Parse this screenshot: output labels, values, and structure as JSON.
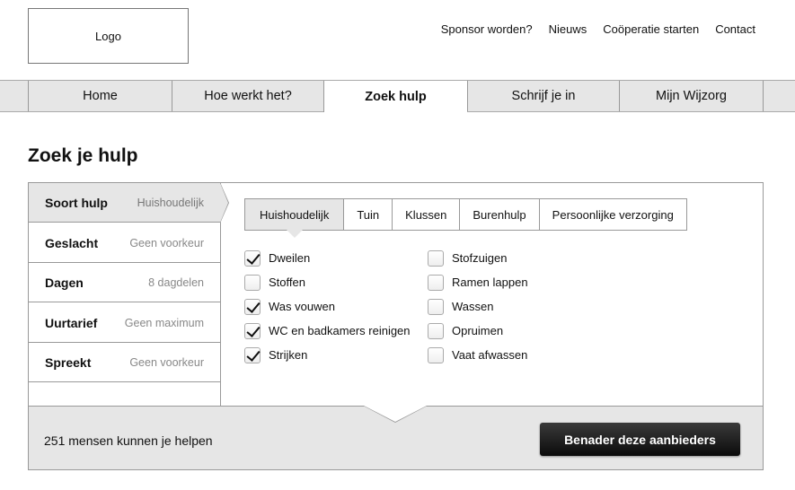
{
  "header": {
    "logo": "Logo",
    "links": [
      "Sponsor worden?",
      "Nieuws",
      "Coöperatie starten",
      "Contact"
    ]
  },
  "nav": {
    "items": [
      "Home",
      "Hoe werkt het?",
      "Zoek hulp",
      "Schrijf je in",
      "Mijn Wijzorg"
    ],
    "active": "Zoek hulp"
  },
  "page": {
    "title": "Zoek je hulp"
  },
  "filters": [
    {
      "label": "Soort hulp",
      "value": "Huishoudelijk",
      "active": true
    },
    {
      "label": "Geslacht",
      "value": "Geen voorkeur",
      "active": false
    },
    {
      "label": "Dagen",
      "value": "8 dagdelen",
      "active": false
    },
    {
      "label": "Uurtarief",
      "value": "Geen maximum",
      "active": false
    },
    {
      "label": "Spreekt",
      "value": "Geen voorkeur",
      "active": false
    }
  ],
  "tabs": {
    "items": [
      "Huishoudelijk",
      "Tuin",
      "Klussen",
      "Burenhulp",
      "Persoonlijke verzorging"
    ],
    "active": "Huishoudelijk"
  },
  "checklist": {
    "left": [
      {
        "label": "Dweilen",
        "checked": true
      },
      {
        "label": "Stoffen",
        "checked": false
      },
      {
        "label": "Was vouwen",
        "checked": true
      },
      {
        "label": "WC en badkamers reinigen",
        "checked": true
      },
      {
        "label": "Strijken",
        "checked": true
      }
    ],
    "right": [
      {
        "label": "Stofzuigen",
        "checked": false
      },
      {
        "label": "Ramen lappen",
        "checked": false
      },
      {
        "label": "Wassen",
        "checked": false
      },
      {
        "label": "Opruimen",
        "checked": false
      },
      {
        "label": "Vaat afwassen",
        "checked": false
      }
    ]
  },
  "footer": {
    "count_text": "251 mensen kunnen je helpen",
    "cta_label": "Benader deze aanbieders"
  }
}
